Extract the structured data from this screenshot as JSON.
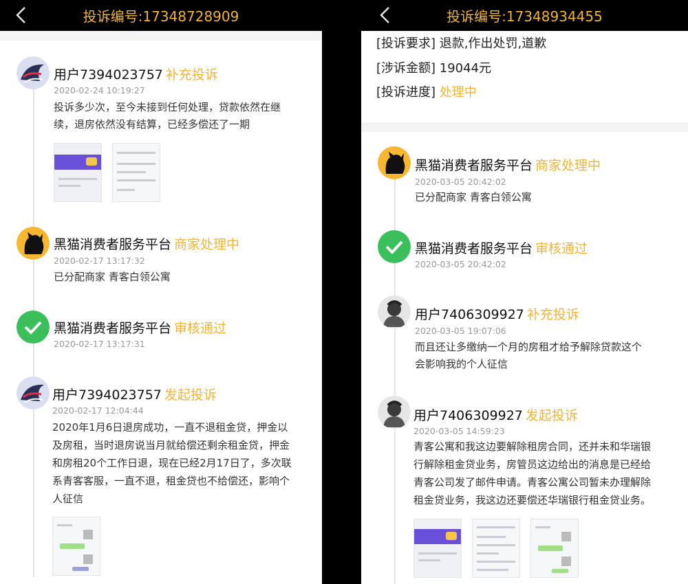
{
  "left": {
    "title": "投诉编号:17348728909",
    "entries": [
      {
        "name": "用户7394023757",
        "status": "补充投诉",
        "time": "2020-02-24 10:19:27",
        "lines": [
          "投诉多少次，至今未接到任何处理，贷款依然在继",
          "续，退房依然没有结算，已经多偿还了一期"
        ]
      },
      {
        "name": "黑猫消费者服务平台",
        "status": "商家处理中",
        "time": "2020-02-17 13:17:32",
        "lines": [
          "已分配商家 青客白领公寓"
        ]
      },
      {
        "name": "黑猫消费者服务平台",
        "status": "审核通过",
        "time": "2020-02-17 13:17:31",
        "lines": []
      },
      {
        "name": "用户7394023757",
        "status": "发起投诉",
        "time": "2020-02-17 12:04:44",
        "lines": [
          "2020年1月6日退房成功，一直不退租金贷，押金以",
          "及房租，当时退房说当月就给偿还剩余租金贷，押金",
          "和房租20个工作日退，现在已经2月17日了，多次联",
          "系青客客服，一直不退，租金贷也不给偿还，影响个",
          "人征信"
        ]
      }
    ]
  },
  "right": {
    "title": "投诉编号:17348934455",
    "info": [
      {
        "label": "[投诉要求]",
        "value": "退款,作出处罚,道歉"
      },
      {
        "label": "[涉诉金额]",
        "value": "19044元"
      },
      {
        "label": "[投诉进度]",
        "value": "处理中"
      }
    ],
    "entries": [
      {
        "name": "黑猫消费者服务平台",
        "status": "商家处理中",
        "time": "2020-03-05 20:42:02",
        "lines": [
          "已分配商家 青客白领公寓"
        ]
      },
      {
        "name": "黑猫消费者服务平台",
        "status": "审核通过",
        "time": "2020-03-05 20:42:02",
        "lines": []
      },
      {
        "name": "用户7406309927",
        "status": "补充投诉",
        "time": "2020-03-05 19:07:06",
        "lines": [
          "而且还让多缴纳一个月的房租才给予解除贷款这个",
          "会影响我的个人征信"
        ]
      },
      {
        "name": "用户7406309927",
        "status": "发起投诉",
        "time": "2020-03-05 14:59:23",
        "lines": [
          "青客公寓和我这边要解除租房合同，还并未和华瑞银",
          "行解除租金贷业务，房管员这边给出的消息是已经给",
          "青客公司发了邮件申请。青客公寓公司暂未办理解除",
          "租金贷业务，我这边还要偿还华瑞银行租金贷业务。"
        ]
      }
    ]
  },
  "colors": {
    "accent": "#f2b437",
    "approved": "#3bbf5a",
    "header": "#000000"
  }
}
